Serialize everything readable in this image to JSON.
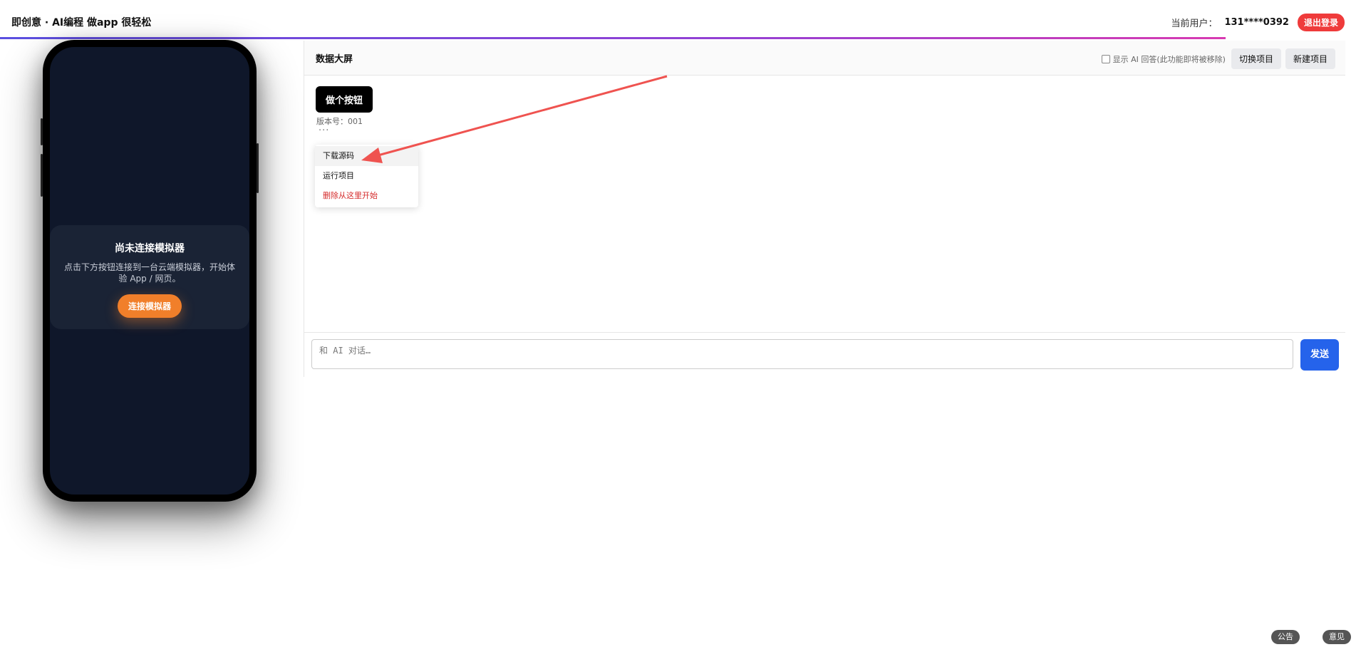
{
  "header": {
    "brand": "即创意 · AI编程 做app 很轻松",
    "user_label": "当前用户：",
    "user_phone": "131****0392",
    "logout_label": "退出登录"
  },
  "simulator": {
    "title": "尚未连接模拟器",
    "description": "点击下方按钮连接到一台云端模拟器，开始体验 App / 网页。",
    "connect_label": "连接模拟器"
  },
  "panel": {
    "title": "数据大屏",
    "show_ai_label": "显示 AI 回答(此功能即将被移除)",
    "show_ai_checked": false,
    "switch_project_label": "切换项目",
    "new_project_label": "新建项目"
  },
  "message": {
    "prompt": "做个按钮",
    "version": "版本号：001",
    "more": "···"
  },
  "context_menu": {
    "items": [
      {
        "label": "下载源码"
      },
      {
        "label": "运行项目"
      },
      {
        "label": "删除从这里开始"
      }
    ]
  },
  "chat": {
    "placeholder": "和 AI 对话…",
    "send_label": "发送"
  },
  "floating": {
    "notice_label": "公告",
    "feedback_label": "意见"
  },
  "colors": {
    "logout": "#ef3b3b",
    "connect": "#f17f2a",
    "send": "#2563eb",
    "danger": "#d52b2b",
    "annotation_arrow": "#ef5350"
  }
}
